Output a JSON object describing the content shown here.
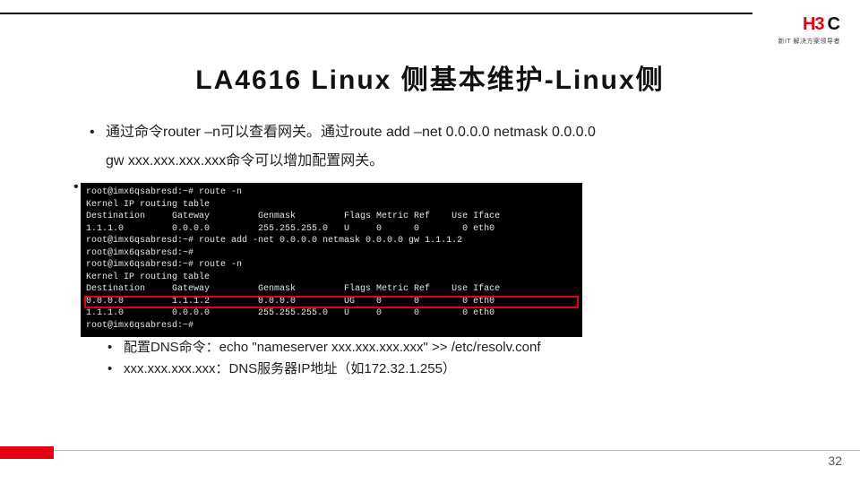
{
  "logo": {
    "left": "H3",
    "right": "C",
    "sub": "新IT 解决方案领导者"
  },
  "title": "LA4616 Linux 侧基本维护-Linux侧",
  "bullets": {
    "b1a": "通过命令router –n可以查看网关。通过route add –net 0.0.0.0 netmask 0.0.0.0",
    "b1b": "gw xxx.xxx.xxx.xxx命令可以增加配置网关。",
    "b2": "配置DNS命令：echo  \"nameserver xxx.xxx.xxx.xxx\"  >> /etc/resolv.conf",
    "b3": "xxx.xxx.xxx.xxx：DNS服务器IP地址（如172.32.1.255）"
  },
  "terminal": {
    "lines": [
      "root@imx6qsabresd:~# route -n",
      "Kernel IP routing table",
      "Destination     Gateway         Genmask         Flags Metric Ref    Use Iface",
      "1.1.1.0         0.0.0.0         255.255.255.0   U     0      0        0 eth0",
      "root@imx6qsabresd:~# route add -net 0.0.0.0 netmask 0.0.0.0 gw 1.1.1.2",
      "root@imx6qsabresd:~#",
      "root@imx6qsabresd:~# route -n",
      "Kernel IP routing table",
      "Destination     Gateway         Genmask         Flags Metric Ref    Use Iface",
      "0.0.0.0         1.1.1.2         0.0.0.0         UG    0      0        0 eth0",
      "1.1.1.0         0.0.0.0         255.255.255.0   U     0      0        0 eth0",
      "root@imx6qsabresd:~# "
    ],
    "highlight_index": 9
  },
  "page_number": "32"
}
